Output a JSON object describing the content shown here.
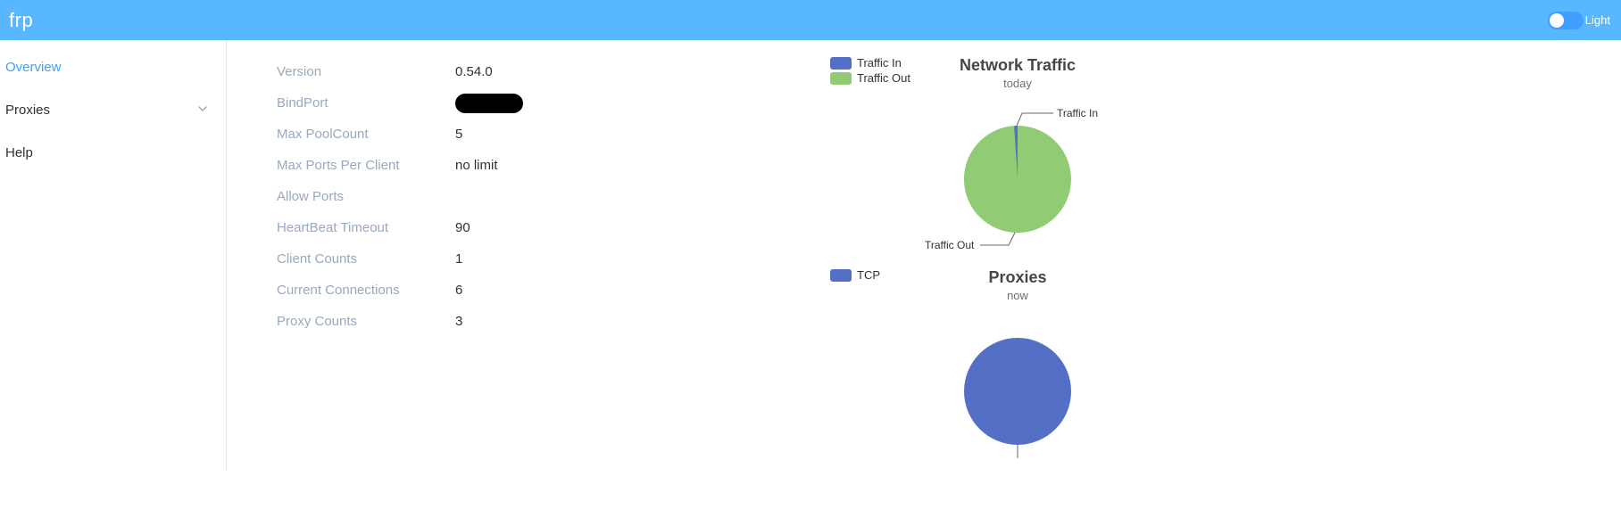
{
  "header": {
    "title": "frp",
    "theme_label": "Light"
  },
  "sidebar": {
    "items": [
      {
        "label": "Overview",
        "active": true,
        "submenu": false
      },
      {
        "label": "Proxies",
        "active": false,
        "submenu": true
      },
      {
        "label": "Help",
        "active": false,
        "submenu": false
      }
    ]
  },
  "stats": [
    {
      "label": "Version",
      "value": "0.54.0"
    },
    {
      "label": "BindPort",
      "value": "",
      "redacted": true
    },
    {
      "label": "Max PoolCount",
      "value": "5"
    },
    {
      "label": "Max Ports Per Client",
      "value": "no limit"
    },
    {
      "label": "Allow Ports",
      "value": ""
    },
    {
      "label": "HeartBeat Timeout",
      "value": "90"
    },
    {
      "label": "Client Counts",
      "value": "1"
    },
    {
      "label": "Current Connections",
      "value": "6"
    },
    {
      "label": "Proxy Counts",
      "value": "3"
    }
  ],
  "charts": {
    "traffic": {
      "title": "Network Traffic",
      "sub": "today",
      "legend_in": "Traffic In",
      "legend_out": "Traffic Out",
      "label_in": "Traffic In",
      "label_out": "Traffic Out"
    },
    "proxies": {
      "title": "Proxies",
      "sub": "now",
      "legend_tcp": "TCP"
    }
  },
  "chart_data": [
    {
      "type": "pie",
      "title": "Network Traffic",
      "subtitle": "today",
      "series": [
        {
          "name": "Traffic In",
          "value": 1,
          "color": "#5470c6"
        },
        {
          "name": "Traffic Out",
          "value": 99,
          "color": "#91cc75"
        }
      ]
    },
    {
      "type": "pie",
      "title": "Proxies",
      "subtitle": "now",
      "series": [
        {
          "name": "TCP",
          "value": 3,
          "color": "#5470c6"
        }
      ]
    }
  ]
}
